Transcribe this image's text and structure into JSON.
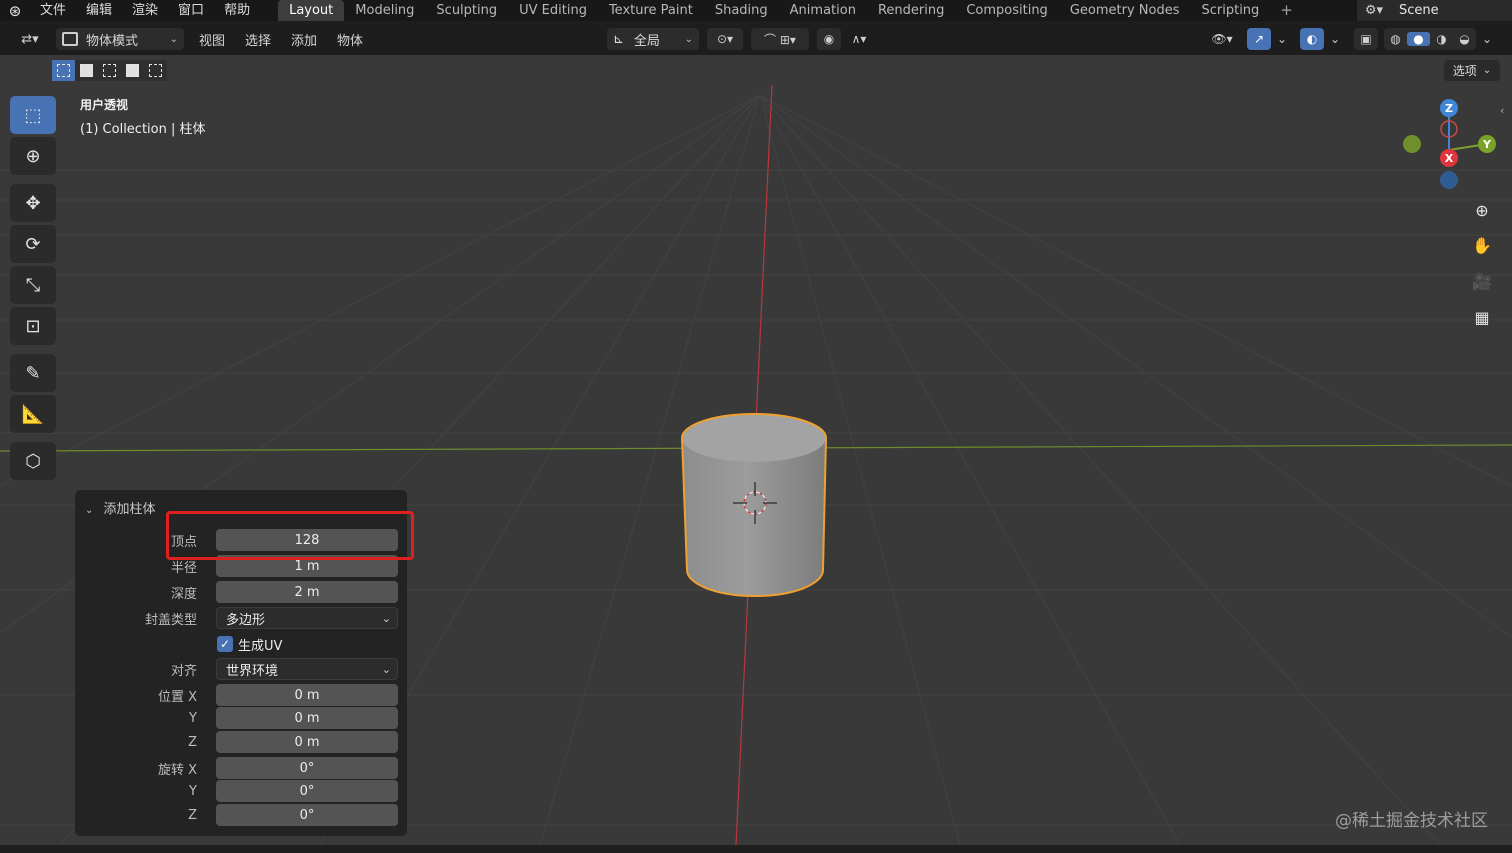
{
  "topbar": {
    "menus": [
      "文件",
      "编辑",
      "渲染",
      "窗口",
      "帮助"
    ],
    "workspaces": [
      "Layout",
      "Modeling",
      "Sculpting",
      "UV Editing",
      "Texture Paint",
      "Shading",
      "Animation",
      "Rendering",
      "Compositing",
      "Geometry Nodes",
      "Scripting"
    ],
    "active_workspace": "Layout",
    "add_tab": "+",
    "scene": "Scene"
  },
  "header": {
    "mode": "物体模式",
    "menus": [
      "视图",
      "选择",
      "添加",
      "物体"
    ],
    "orientation": "全局",
    "options": "选项"
  },
  "viewport": {
    "view_name": "用户透视",
    "collection": "(1) Collection | 柱体"
  },
  "gizmo": {
    "z": "Z",
    "y": "Y",
    "x": "X"
  },
  "operator": {
    "title": "添加柱体",
    "rows": [
      {
        "label": "顶点",
        "value": "128"
      },
      {
        "label": "半径",
        "value": "1 m"
      },
      {
        "label": "深度",
        "value": "2 m"
      }
    ],
    "cap_type_label": "封盖类型",
    "cap_type_value": "多边形",
    "gen_uv_label": "生成UV",
    "align_label": "对齐",
    "align_value": "世界环境",
    "location_label": "位置 X",
    "location": [
      "0 m",
      "0 m",
      "0 m"
    ],
    "rotation_label": "旋转 X",
    "rotation": [
      "0°",
      "0°",
      "0°"
    ],
    "axis_y": "Y",
    "axis_z": "Z"
  },
  "watermark": "@稀土掘金技术社区",
  "colors": {
    "accent": "#4772b3",
    "selection_outline": "#f0a030",
    "highlight_box": "#e0201e",
    "axis_x": "#c83a3a",
    "axis_y": "#7aa32a",
    "axis_z": "#3f86d6"
  }
}
